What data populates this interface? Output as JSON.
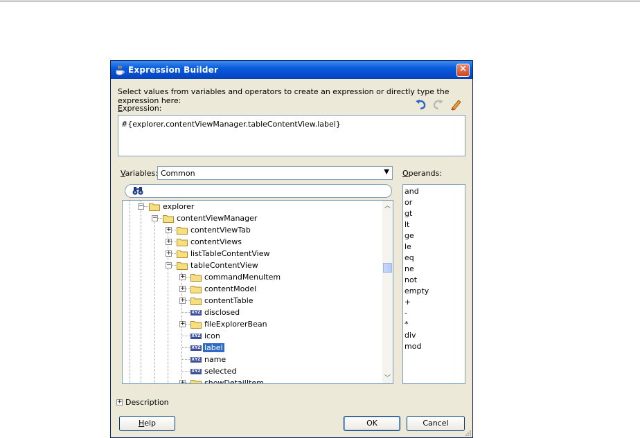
{
  "dialog": {
    "title": "Expression Builder",
    "instruction": "Select values from variables and operators to create an expression or directly type the expression here:",
    "expression_label": "Expression:",
    "expression_value": "#{explorer.contentViewManager.tableContentView.label}",
    "variables_label": "Variables:",
    "variables_selected": "Common",
    "operands_label": "Operands:",
    "description_label": "Description"
  },
  "toolbar": {
    "undo_icon": "undo-icon",
    "redo_icon": "redo-icon",
    "clear_icon": "eraser-icon"
  },
  "tree": {
    "nodes": [
      {
        "label": "explorer",
        "type": "folder",
        "expanded": true
      },
      {
        "label": "contentViewManager",
        "type": "folder",
        "expanded": true
      },
      {
        "label": "contentViewTab",
        "type": "folder",
        "expanded": false
      },
      {
        "label": "contentViews",
        "type": "folder",
        "expanded": false
      },
      {
        "label": "listTableContentView",
        "type": "folder",
        "expanded": false
      },
      {
        "label": "tableContentView",
        "type": "folder",
        "expanded": true
      },
      {
        "label": "commandMenuItem",
        "type": "folder",
        "expanded": false
      },
      {
        "label": "contentModel",
        "type": "folder",
        "expanded": false
      },
      {
        "label": "contentTable",
        "type": "folder",
        "expanded": false
      },
      {
        "label": "disclosed",
        "type": "property"
      },
      {
        "label": "fileExplorerBean",
        "type": "folder",
        "expanded": false
      },
      {
        "label": "icon",
        "type": "property"
      },
      {
        "label": "label",
        "type": "property",
        "selected": true
      },
      {
        "label": "name",
        "type": "property"
      },
      {
        "label": "selected",
        "type": "property"
      },
      {
        "label": "showDetailItem",
        "type": "folder",
        "expanded": false
      }
    ]
  },
  "operands": [
    "and",
    "or",
    "gt",
    "lt",
    "ge",
    "le",
    "eq",
    "ne",
    "not",
    "empty",
    "+",
    "-",
    "*",
    "div",
    "mod"
  ],
  "buttons": {
    "help": "Help",
    "ok": "OK",
    "cancel": "Cancel"
  },
  "colors": {
    "titlebar": "#0a5bdc",
    "selection": "#316ac5",
    "dialog_bg": "#ece9d8"
  }
}
